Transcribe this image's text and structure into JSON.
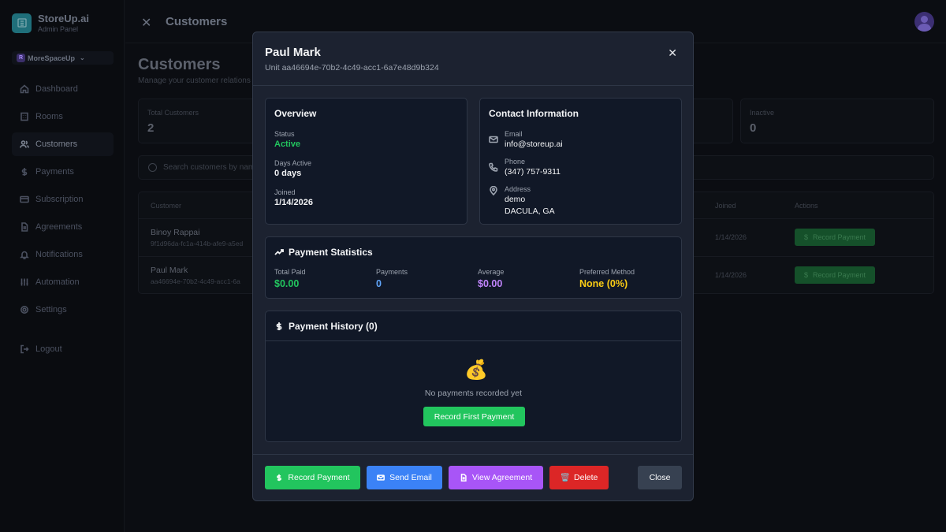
{
  "app": {
    "name": "StoreUp.ai",
    "subtitle": "Admin Panel",
    "workspace": "MoreSpaceUp",
    "workspace_initial": "R"
  },
  "sidebar": {
    "items": [
      {
        "label": "Dashboard",
        "icon": "home-icon"
      },
      {
        "label": "Rooms",
        "icon": "building-icon"
      },
      {
        "label": "Customers",
        "icon": "users-icon",
        "active": true
      },
      {
        "label": "Payments",
        "icon": "dollar-icon"
      },
      {
        "label": "Subscription",
        "icon": "card-icon"
      },
      {
        "label": "Agreements",
        "icon": "document-icon"
      },
      {
        "label": "Notifications",
        "icon": "bell-icon"
      },
      {
        "label": "Automation",
        "icon": "sliders-icon"
      },
      {
        "label": "Settings",
        "icon": "gear-icon"
      }
    ],
    "logout": "Logout"
  },
  "topbar": {
    "title": "Customers",
    "close_glyph": "✕"
  },
  "page": {
    "title": "Customers",
    "subtitle": "Manage your customer relations",
    "stats": [
      {
        "label": "Total Customers",
        "value": "2"
      },
      {
        "label": "Inactive",
        "value": "0"
      }
    ],
    "search_placeholder": "Search customers by name",
    "table": {
      "headers": {
        "customer": "Customer",
        "joined": "Joined",
        "actions": "Actions"
      },
      "rows": [
        {
          "name": "Binoy Rappai",
          "id": "9f1d96da-fc1a-414b-afe9-a5ed",
          "joined": "1/14/2026",
          "action": "Record Payment"
        },
        {
          "name": "Paul Mark",
          "id": "aa46694e-70b2-4c49-acc1-6a",
          "joined": "1/14/2026",
          "action": "Record Payment"
        }
      ]
    }
  },
  "modal": {
    "title": "Paul Mark",
    "subtitle": "Unit aa46694e-70b2-4c49-acc1-6a7e48d9b324",
    "close_glyph": "✕",
    "overview": {
      "title": "Overview",
      "status_label": "Status",
      "status_value": "Active",
      "days_label": "Days Active",
      "days_value": "0 days",
      "joined_label": "Joined",
      "joined_value": "1/14/2026"
    },
    "contact": {
      "title": "Contact Information",
      "email_label": "Email",
      "email_value": "info@storeup.ai",
      "phone_label": "Phone",
      "phone_value": "(347) 757-9311",
      "address_label": "Address",
      "address_line1": "demo",
      "address_line2": "DACULA, GA"
    },
    "stats": {
      "title": "Payment Statistics",
      "total_paid_label": "Total Paid",
      "total_paid_value": "$0.00",
      "payments_label": "Payments",
      "payments_value": "0",
      "average_label": "Average",
      "average_value": "$0.00",
      "method_label": "Preferred Method",
      "method_value": "None (0%)"
    },
    "history": {
      "title": "Payment History (0)",
      "empty_emoji": "💰",
      "empty_text": "No payments recorded yet",
      "first_button": "Record First Payment"
    },
    "footer": {
      "record": "Record Payment",
      "email": "Send Email",
      "agreement": "View Agreement",
      "delete": "Delete",
      "delete_glyph": "🗑️",
      "close": "Close"
    }
  },
  "colors": {
    "green": "#22c55e",
    "blue": "#3b82f6",
    "purple": "#a855f7",
    "red": "#dc2626",
    "stat_green": "#22c55e",
    "stat_blue": "#60a5fa",
    "stat_purple": "#c084fc",
    "stat_yellow": "#facc15"
  }
}
